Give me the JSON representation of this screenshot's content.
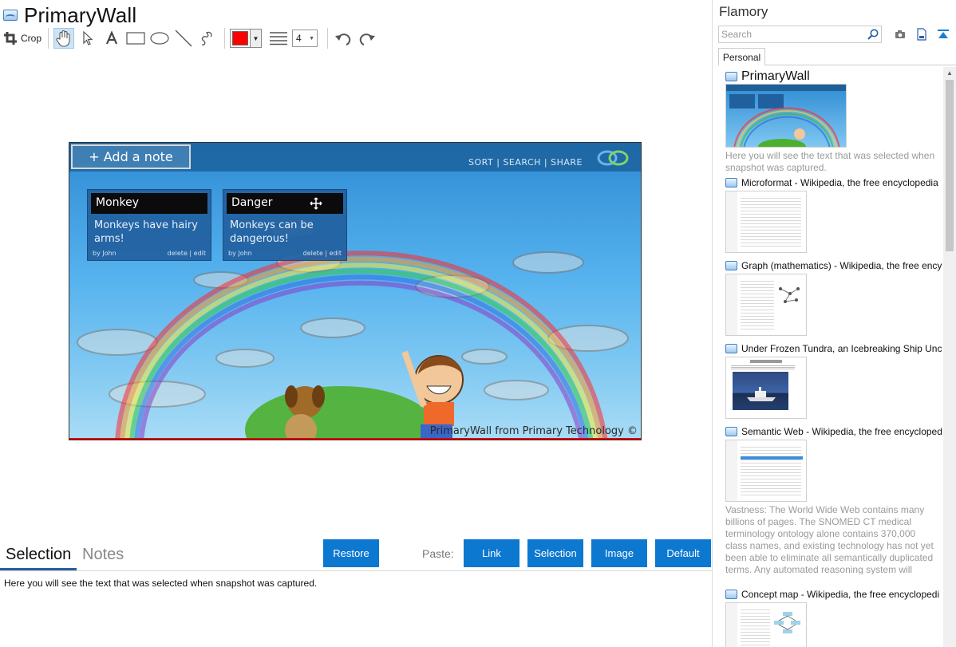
{
  "document": {
    "title": "PrimaryWall"
  },
  "toolbar": {
    "crop_label": "Crop",
    "line_width": "4",
    "color": "#ff0000"
  },
  "snapshot": {
    "add_note": "+ Add a note",
    "links": "SORT | SEARCH | SHARE",
    "notes": [
      {
        "title": "Monkey",
        "body": "Monkeys have hairy arms!",
        "author": "by John",
        "actions": "delete | edit"
      },
      {
        "title": "Danger",
        "body": "Monkeys can be dangerous!",
        "author": "by John",
        "actions": "delete | edit"
      }
    ],
    "caption": "PrimaryWall from Primary Technology ©"
  },
  "bottom": {
    "tab_selection": "Selection",
    "tab_notes": "Notes",
    "restore_label": "Restore",
    "paste_label": "Paste:",
    "link_label": "Link",
    "selection_label": "Selection",
    "image_label": "Image",
    "default_label": "Default",
    "selected_text": "Here you will see the text that was selected when snapshot was captured."
  },
  "sidebar": {
    "title": "Flamory",
    "search_placeholder": "Search",
    "tab_personal": "Personal",
    "entries": [
      {
        "title": "PrimaryWall",
        "desc": "Here you will see the text that was selected when snapshot was captured."
      },
      {
        "title": "Microformat - Wikipedia, the free encyclopedia",
        "desc": ""
      },
      {
        "title": "Graph (mathematics) - Wikipedia, the free encyc",
        "desc": ""
      },
      {
        "title": "Under Frozen Tundra, an Icebreaking Ship Unco",
        "desc": ""
      },
      {
        "title": "Semantic Web - Wikipedia, the free encycloped",
        "desc": "Vastness: The World Wide Web contains many billions of pages. The SNOMED CT medical terminology ontology alone contains 370,000 class names, and existing technology has not yet been able to eliminate all semantically duplicated terms. Any automated reasoning system will have to deal with truly huge inputs."
      },
      {
        "title": "Concept map - Wikipedia, the free encyclopedi",
        "desc": ""
      }
    ]
  },
  "colors": {
    "accent": "#0d78d0",
    "tab_underline": "#2b5d9c"
  }
}
